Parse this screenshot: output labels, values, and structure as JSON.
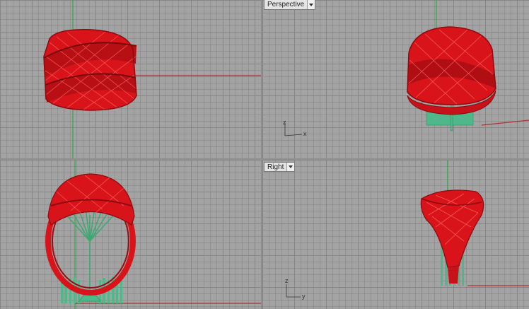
{
  "viewports": {
    "top": {
      "label": ""
    },
    "perspective": {
      "label": "Perspective",
      "gizmo_h": "x",
      "gizmo_v": "z"
    },
    "front": {
      "label": ""
    },
    "right": {
      "label": "Right",
      "gizmo_h": "y",
      "gizmo_v": "z"
    }
  },
  "icons": {
    "menu": "chevron-down-icon"
  },
  "colors": {
    "model_red": "#e0141b",
    "model_dark_red": "#8c0a0e",
    "support_green": "#4fb88a",
    "x_axis": "#b03030",
    "y_axis": "#2fa84f",
    "grid_bg": "#a3a3a3"
  }
}
